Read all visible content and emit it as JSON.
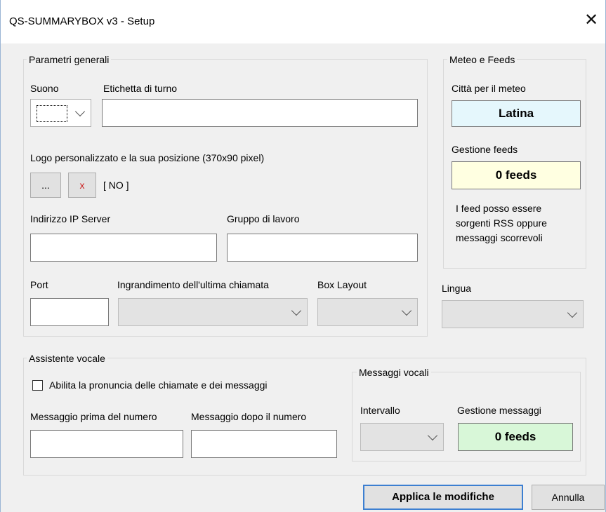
{
  "window": {
    "title": "QS-SUMMARYBOX v3 - Setup"
  },
  "general": {
    "legend": "Parametri generali",
    "sound_label": "Suono",
    "shift_label": "Etichetta di turno",
    "logo_label": "Logo personalizzato e la sua posizione (370x90 pixel)",
    "browse_button": "...",
    "clear_button": "x",
    "logo_status": "[ NO ]",
    "server_ip_label": "Indirizzo IP Server",
    "workgroup_label": "Gruppo di lavoro",
    "port_label": "Port",
    "zoom_label": "Ingrandimento dell'ultima chiamata",
    "box_layout_label": "Box Layout"
  },
  "weather": {
    "legend": "Meteo e Feeds",
    "city_label": "Città per il meteo",
    "city_value": "Latina",
    "feeds_label": "Gestione feeds",
    "feeds_value": "0 feeds",
    "feeds_note_1": "I feed posso essere",
    "feeds_note_2": "sorgenti RSS oppure",
    "feeds_note_3": "messaggi scorrevoli"
  },
  "language": {
    "label": "Lingua"
  },
  "voice": {
    "legend": "Assistente vocale",
    "enable_label": "Abilita la pronuncia delle chiamate e dei messaggi",
    "before_label": "Messaggio prima del numero",
    "after_label": "Messaggio dopo il numero",
    "messages_legend": "Messaggi vocali",
    "interval_label": "Intervallo",
    "manage_label": "Gestione messaggi",
    "manage_value": "0 feeds"
  },
  "buttons": {
    "apply": "Applica le modifiche",
    "cancel": "Annulla"
  },
  "colors": {
    "city_bg": "#e5f7fc",
    "feeds_bg": "#ffffe1",
    "messages_bg": "#d8f7d8"
  }
}
